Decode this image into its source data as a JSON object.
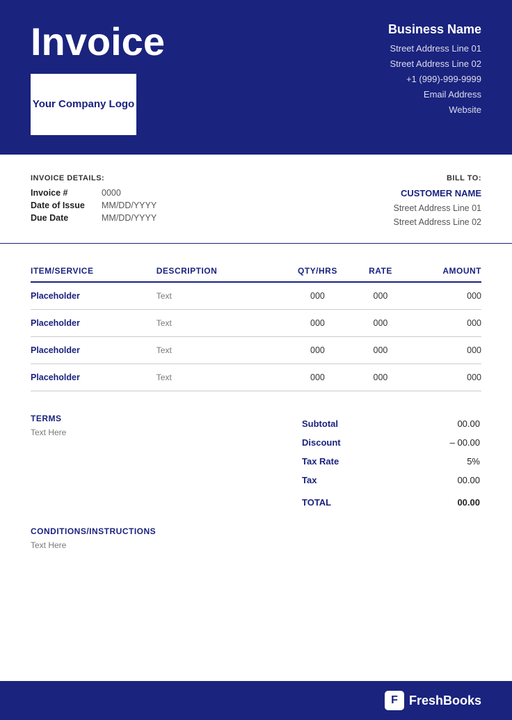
{
  "header": {
    "invoice_title": "Invoice",
    "logo_text": "Your Company Logo",
    "business_name": "Business Name",
    "address_line1": "Street Address Line 01",
    "address_line2": "Street Address Line 02",
    "phone": "+1 (999)-999-9999",
    "email": "Email Address",
    "website": "Website"
  },
  "invoice_details": {
    "section_label": "INVOICE DETAILS:",
    "fields": [
      {
        "label": "Invoice #",
        "value": "0000"
      },
      {
        "label": "Date of Issue",
        "value": "MM/DD/YYYY"
      },
      {
        "label": "Due Date",
        "value": "MM/DD/YYYY"
      }
    ]
  },
  "bill_to": {
    "section_label": "BILL TO:",
    "customer_name": "CUSTOMER NAME",
    "address_line1": "Street Address Line 01",
    "address_line2": "Street Address Line 02"
  },
  "table": {
    "headers": [
      "ITEM/SERVICE",
      "DESCRIPTION",
      "QTY/HRS",
      "RATE",
      "AMOUNT"
    ],
    "rows": [
      {
        "item": "Placeholder",
        "description": "Text",
        "qty": "000",
        "rate": "000",
        "amount": "000"
      },
      {
        "item": "Placeholder",
        "description": "Text",
        "qty": "000",
        "rate": "000",
        "amount": "000"
      },
      {
        "item": "Placeholder",
        "description": "Text",
        "qty": "000",
        "rate": "000",
        "amount": "000"
      },
      {
        "item": "Placeholder",
        "description": "Text",
        "qty": "000",
        "rate": "000",
        "amount": "000"
      }
    ]
  },
  "terms": {
    "label": "TERMS",
    "text": "Text Here"
  },
  "totals": {
    "subtotal_label": "Subtotal",
    "subtotal_value": "00.00",
    "discount_label": "Discount",
    "discount_value": "– 00.00",
    "taxrate_label": "Tax Rate",
    "taxrate_value": "5%",
    "tax_label": "Tax",
    "tax_value": "00.00",
    "total_label": "TOTAL",
    "total_value": "00.00"
  },
  "conditions": {
    "label": "CONDITIONS/INSTRUCTIONS",
    "text": "Text Here"
  },
  "freshbooks": {
    "icon_letter": "F",
    "brand_name": "FreshBooks"
  }
}
